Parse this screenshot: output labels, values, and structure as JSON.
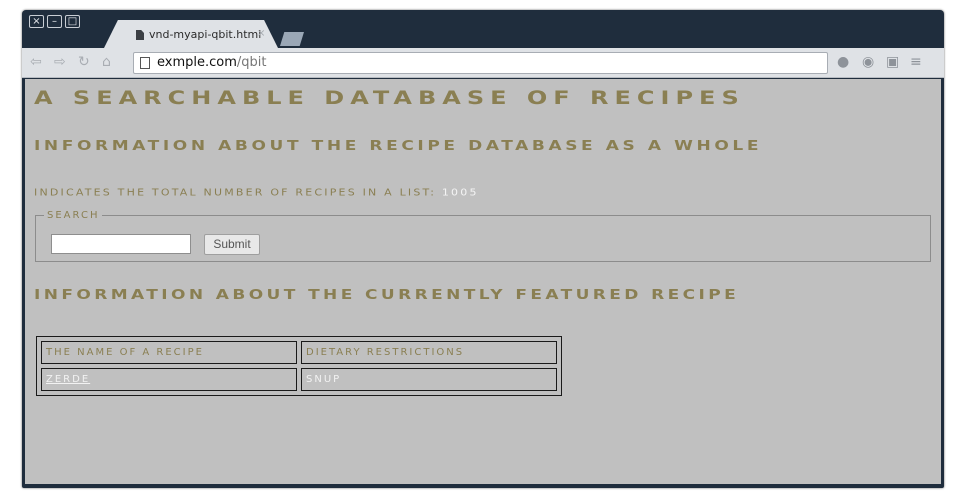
{
  "browser": {
    "tab_title": "vnd-myapi-qbit.html",
    "tab_close": "×",
    "url_host": "exmple.com",
    "url_path": "/qbit",
    "window_buttons": [
      "×",
      "–",
      "□"
    ],
    "nav_icons": [
      "back-icon",
      "forward-icon",
      "reload-icon",
      "home-icon"
    ],
    "toolbar_icons": [
      "extension-icon",
      "pocket-icon",
      "folder-icon",
      "menu-icon"
    ]
  },
  "page": {
    "title": "A searchable database of recipes",
    "section_database": "Information about the recipe database as a whole",
    "count_label": "Indicates the total number of recipes in a list:",
    "count_value": "1005",
    "search": {
      "legend": "Search",
      "input_value": "",
      "submit_label": "Submit"
    },
    "section_featured": "Information about the currently featured recipe",
    "table": {
      "headers": [
        "The name of a recipe",
        "Dietary restrictions"
      ],
      "rows": [
        [
          "Zerde",
          "snup"
        ]
      ]
    }
  },
  "colors": {
    "heading": "#8a7f52",
    "page_background": "#c0c0c0",
    "frame": "#1f2d3d",
    "value_text": "#f2f2f2"
  }
}
